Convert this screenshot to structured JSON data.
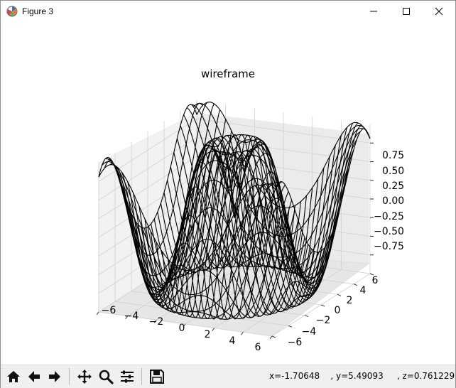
{
  "window": {
    "title": "Figure 3",
    "controls": [
      "minimize",
      "maximize",
      "close"
    ]
  },
  "plot": {
    "title": "wireframe",
    "x_ticks": [
      "−6",
      "−4",
      "−2",
      "0",
      "2",
      "4",
      "6"
    ],
    "y_ticks": [
      "−6",
      "−4",
      "−2",
      "0",
      "2",
      "4",
      "6"
    ],
    "z_ticks": [
      "0.75",
      "0.50",
      "0.25",
      "0.00",
      "−0.25",
      "−0.50",
      "−0.75"
    ]
  },
  "chart_data": {
    "type": "surface-wireframe",
    "title": "wireframe",
    "function": "z = sin(sqrt(x^2 + y^2))",
    "xlim": [
      -6,
      6
    ],
    "ylim": [
      -6,
      6
    ],
    "zlim": [
      -1,
      1
    ],
    "x_ticks": [
      -6,
      -4,
      -2,
      0,
      2,
      4,
      6
    ],
    "y_ticks": [
      -6,
      -4,
      -2,
      0,
      2,
      4,
      6
    ],
    "z_ticks": [
      -0.75,
      -0.5,
      -0.25,
      0.0,
      0.25,
      0.5,
      0.75
    ],
    "line_color": "#000000",
    "grid": true
  },
  "toolbar": {
    "buttons": [
      "home-icon",
      "back-icon",
      "forward-icon",
      "pan-icon",
      "zoom-icon",
      "configure-subplots-icon",
      "save-icon"
    ]
  },
  "status": {
    "coords": "x=-1.70648    , y=5.49093     , z=0.761229"
  }
}
